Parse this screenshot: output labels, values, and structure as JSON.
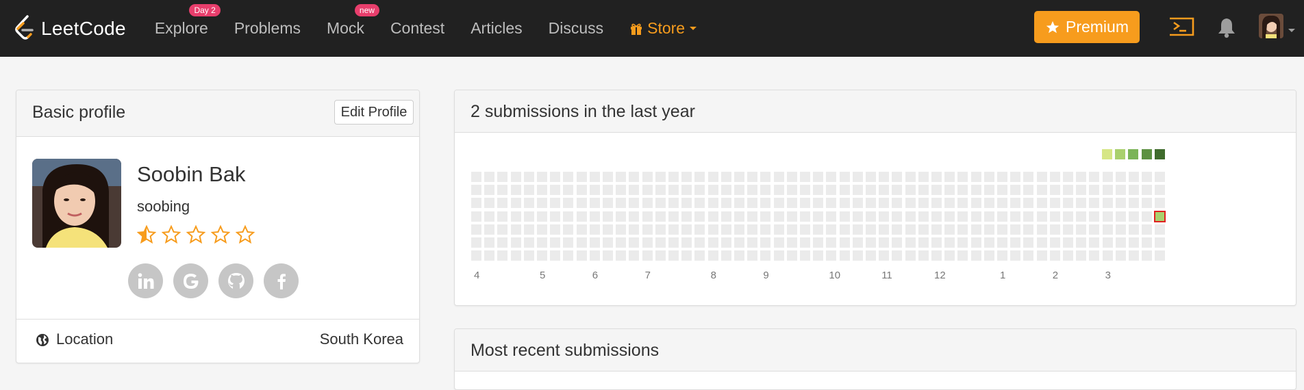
{
  "nav": {
    "logo_text": "LeetCode",
    "items": [
      {
        "label": "Explore",
        "badge": "Day 2"
      },
      {
        "label": "Problems"
      },
      {
        "label": "Mock",
        "badge": "new"
      },
      {
        "label": "Contest"
      },
      {
        "label": "Articles"
      },
      {
        "label": "Discuss"
      }
    ],
    "store_label": "Store",
    "premium_label": "Premium",
    "accent_color": "#f79c1d",
    "badge_color": "#e83e6c"
  },
  "profile": {
    "header": "Basic profile",
    "edit_label": "Edit Profile",
    "real_name": "Soobin Bak",
    "username": "soobing",
    "rating_stars": 0.5,
    "rating_max": 5,
    "socials": [
      {
        "icon": "linkedin-icon",
        "glyph": "in"
      },
      {
        "icon": "google-icon",
        "glyph": "G"
      },
      {
        "icon": "github-icon",
        "glyph": "gh"
      },
      {
        "icon": "facebook-icon",
        "glyph": "f"
      }
    ],
    "location_label": "Location",
    "location_value": "South Korea"
  },
  "submissions": {
    "header": "2 submissions in the last year",
    "months": [
      "4",
      "5",
      "6",
      "7",
      "8",
      "9",
      "10",
      "11",
      "12",
      "1",
      "2",
      "3"
    ],
    "legend_colors": [
      "#d6e685",
      "#a9d06d",
      "#7bb458",
      "#5d9142",
      "#3f6b2c"
    ],
    "empty_color": "#ebebeb",
    "active_color": "#a9d06d",
    "active_border_color": "#e02020"
  },
  "recent": {
    "header": "Most recent submissions"
  }
}
